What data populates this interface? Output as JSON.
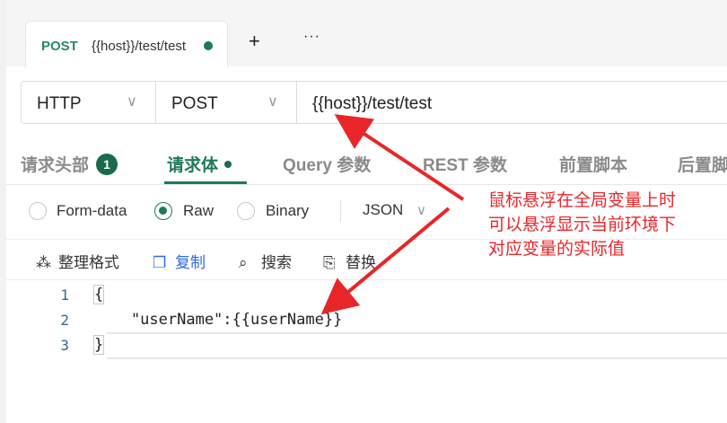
{
  "tab": {
    "method": "POST",
    "url": "{{host}}/test/test"
  },
  "tabbar": {
    "add_icon": "+",
    "more_icon": "···"
  },
  "request": {
    "protocol": "HTTP",
    "method": "POST",
    "url": "{{host}}/test/test",
    "chevron": "∨"
  },
  "subtabs": {
    "headers": "请求头部",
    "headers_count": "1",
    "body": "请求体",
    "query": "Query 参数",
    "rest": "REST 参数",
    "pre": "前置脚本",
    "post": "后置脚"
  },
  "body_types": {
    "form": "Form-data",
    "raw": "Raw",
    "binary": "Binary",
    "format": "JSON",
    "selected": "Raw"
  },
  "toolbar": {
    "beautify": "整理格式",
    "copy": "复制",
    "search": "搜索",
    "replace": "替换"
  },
  "editor": {
    "line_numbers": [
      "1",
      "2",
      "3"
    ],
    "lines": [
      "{",
      "    \"userName\":{{userName}}",
      "}"
    ]
  },
  "annotation": {
    "lines": [
      "鼠标悬浮在全局变量上时",
      "可以悬浮显示当前环境下",
      "对应变量的实际值"
    ]
  },
  "colors": {
    "accent": "#1f7a55",
    "annotation": "#e8262a",
    "link": "#2f6ad9"
  }
}
